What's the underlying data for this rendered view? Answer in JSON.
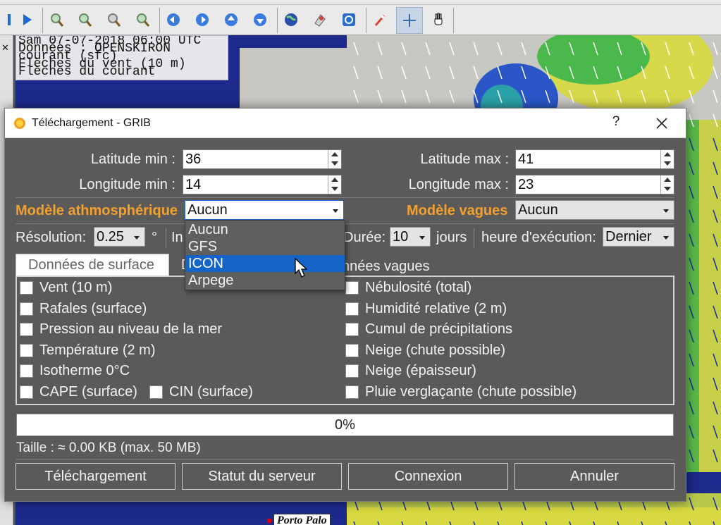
{
  "map": {
    "info_lines": [
      "Sam 07-07-2018 06:00 UTC",
      "Données : OPENSKIRON",
      "courant (sfc)",
      "Flèches du vent (10 m)",
      "Flèches du courant"
    ],
    "place_label": "Porto Palo"
  },
  "dialog": {
    "title": "Téléchargement - GRIB",
    "help": "?",
    "lat_min_label": "Latitude min :",
    "lat_min": "36",
    "lat_max_label": "Latitude max :",
    "lat_max": "41",
    "lon_min_label": "Longitude min :",
    "lon_min": "14",
    "lon_max_label": "Longitude max :",
    "lon_max": "23",
    "atm_model_label": "Modèle athmosphérique",
    "atm_model_value": "Aucun",
    "atm_model_options": [
      "Aucun",
      "GFS",
      "ICON",
      "Arpege"
    ],
    "atm_model_highlighted": "ICON",
    "wave_model_label": "Modèle vagues",
    "wave_model_value": "Aucun",
    "resolution_label": "Résolution:",
    "resolution_value": "0.25",
    "degree": "°",
    "interval_label_partial": "In",
    "duration_label": "Durée:",
    "duration_value": "10",
    "days_label": "jours",
    "exec_label": "heure d'exécution:",
    "exec_value": "Dernier",
    "tabs": [
      "Données de surface",
      "D",
      "nnées vagues"
    ],
    "left_checks": [
      "Vent (10 m)",
      "Rafales (surface)",
      "Pression au niveau de la mer",
      "Température (2 m)",
      "Isotherme 0°C",
      "CAPE (surface)"
    ],
    "cin_check": "CIN (surface)",
    "right_checks": [
      "Nébulosité (total)",
      "Humidité relative (2 m)",
      "Cumul de précipitations",
      "Neige (chute possible)",
      "Neige (épaisseur)",
      "Pluie verglaçante (chute possible)"
    ],
    "progress": "0%",
    "size_text": "Taille : ≈ 0.00 KB (max. 50 MB)",
    "buttons": [
      "Téléchargement",
      "Statut du serveur",
      "Connexion",
      "Annuler"
    ]
  }
}
